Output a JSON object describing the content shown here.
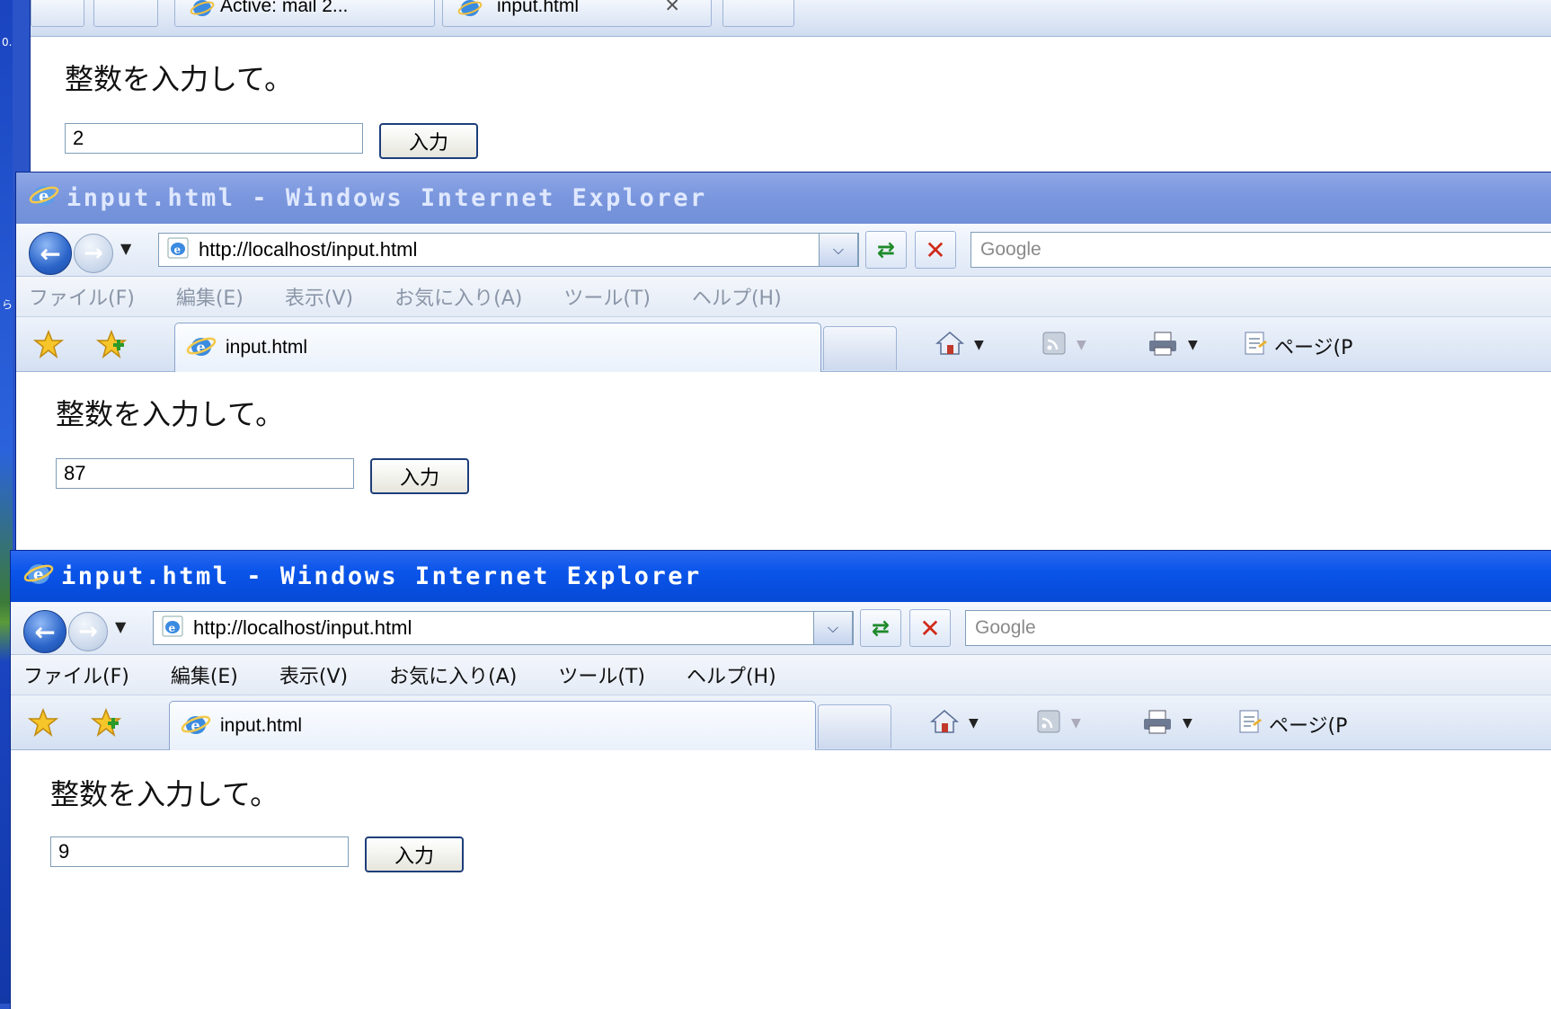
{
  "desktop": {
    "glyphs": [
      "0.",
      "ら"
    ]
  },
  "window_top": {
    "tabs": [
      {
        "label": "Active: mail 2...",
        "active": false
      },
      {
        "label": "input.html",
        "active": true,
        "close": "✕"
      }
    ],
    "prompt": "整数を入力して。",
    "input_value": "2",
    "button_label": "入力"
  },
  "window_middle": {
    "title": "input.html - Windows Internet Explorer",
    "active": false,
    "url": "http://localhost/input.html",
    "search_placeholder": "Google",
    "menu": [
      "ファイル(F)",
      "編集(E)",
      "表示(V)",
      "お気に入り(A)",
      "ツール(T)",
      "ヘルプ(H)"
    ],
    "tab_label": "input.html",
    "page_menu": "ページ(P",
    "prompt": "整数を入力して。",
    "input_value": "87",
    "button_label": "入力"
  },
  "window_bottom": {
    "title": "input.html - Windows Internet Explorer",
    "active": true,
    "url": "http://localhost/input.html",
    "search_placeholder": "Google",
    "menu": [
      "ファイル(F)",
      "編集(E)",
      "表示(V)",
      "お気に入り(A)",
      "ツール(T)",
      "ヘルプ(H)"
    ],
    "tab_label": "input.html",
    "page_menu": "ページ(P",
    "prompt": "整数を入力して。",
    "input_value": "9",
    "button_label": "入力"
  },
  "colors": {
    "title_active": "#0a55ea",
    "title_inactive": "#7b97de",
    "desktop": "#2a54c8"
  },
  "icons": {
    "browser": "ie-icon",
    "back": "back-arrow-icon",
    "forward": "forward-arrow-icon",
    "refresh": "refresh-icon",
    "stop": "stop-icon",
    "favorites": "favorites-star-icon",
    "add_favorite": "add-favorite-icon",
    "home": "home-icon",
    "feed": "feed-icon",
    "print": "print-icon",
    "page": "page-icon"
  }
}
